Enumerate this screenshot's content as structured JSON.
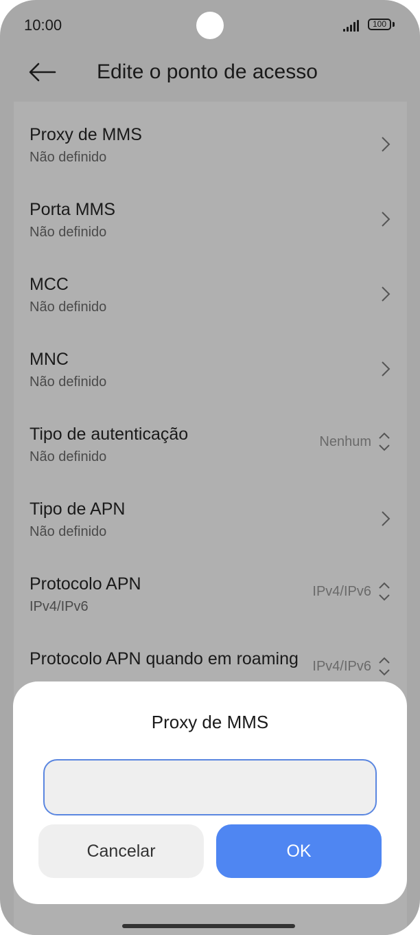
{
  "status_bar": {
    "time": "10:00",
    "battery": "100"
  },
  "header": {
    "title": "Edite o ponto de acesso"
  },
  "items": [
    {
      "title": "Proxy de MMS",
      "subtitle": "Não definido",
      "control": "chevron"
    },
    {
      "title": "Porta MMS",
      "subtitle": "Não definido",
      "control": "chevron"
    },
    {
      "title": "MCC",
      "subtitle": "Não definido",
      "control": "chevron"
    },
    {
      "title": "MNC",
      "subtitle": "Não definido",
      "control": "chevron"
    },
    {
      "title": "Tipo de autenticação",
      "subtitle": "Não definido",
      "control": "dropdown",
      "value": "Nenhum"
    },
    {
      "title": "Tipo de APN",
      "subtitle": "Não definido",
      "control": "chevron"
    },
    {
      "title": "Protocolo APN",
      "subtitle": "IPv4/IPv6",
      "control": "dropdown",
      "value": "IPv4/IPv6"
    },
    {
      "title": "Protocolo APN quando em roaming",
      "subtitle": "",
      "control": "dropdown",
      "value": "IPv4/IPv6"
    }
  ],
  "dialog": {
    "title": "Proxy de MMS",
    "input_value": "",
    "cancel_label": "Cancelar",
    "ok_label": "OK"
  },
  "colors": {
    "accent": "#4f86f2",
    "dim_background": "#a8a8a8",
    "input_border": "#5a86e0"
  }
}
